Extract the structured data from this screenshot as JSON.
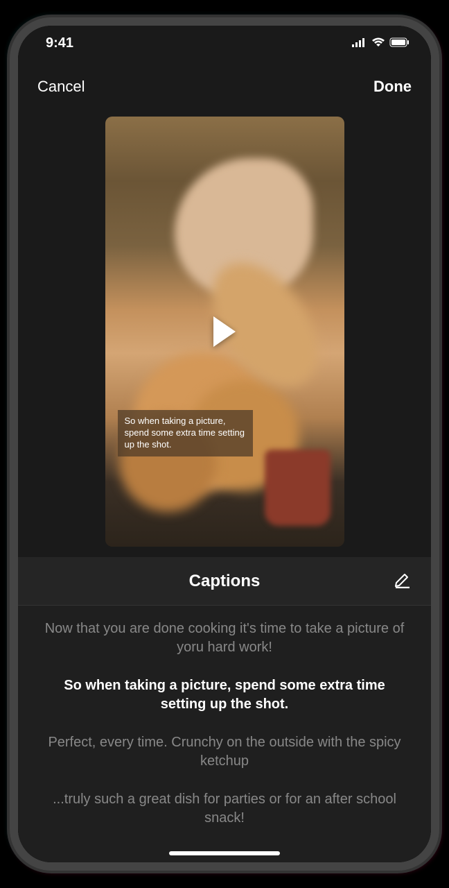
{
  "status": {
    "time": "9:41"
  },
  "nav": {
    "cancel": "Cancel",
    "done": "Done"
  },
  "video": {
    "overlay_caption": "So when taking a picture, spend some extra time setting up the shot."
  },
  "captions": {
    "title": "Captions",
    "lines": [
      "Now that you are done cooking it's time to take a picture of yoru hard work!",
      "So when taking a picture, spend some extra time setting up the shot.",
      "Perfect, every time. Crunchy on the outside with the spicy ketchup",
      "...truly such a great dish for parties or for an after school snack!"
    ],
    "active_index": 1
  }
}
